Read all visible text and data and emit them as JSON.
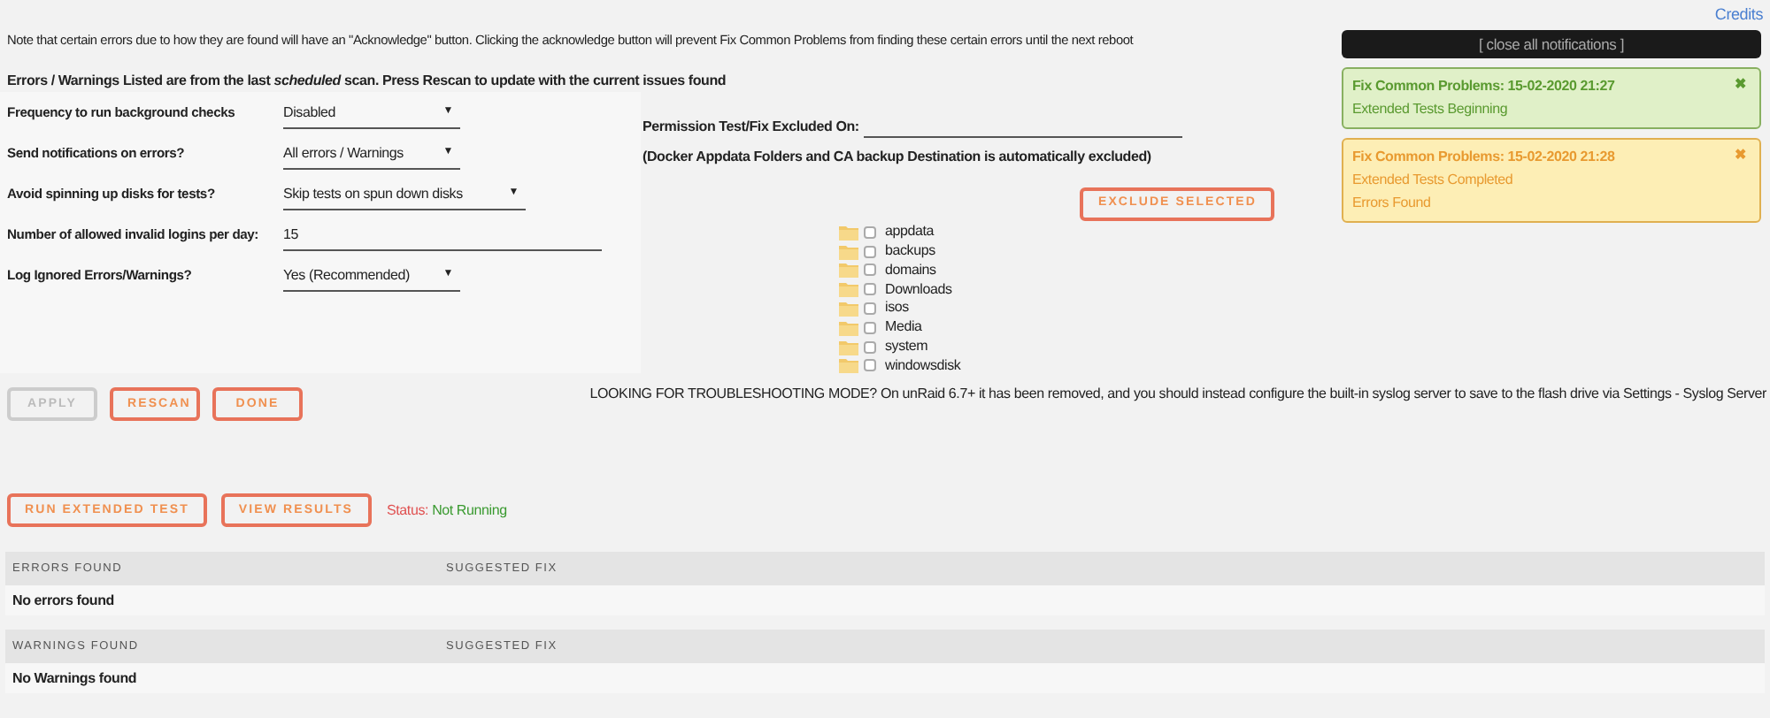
{
  "credits": "Credits",
  "note": "Note that certain errors due to how they are found will have an \"Acknowledge\" button. Clicking the acknowledge button will prevent Fix Common Problems from finding these certain errors until the next reboot",
  "scan_note": "Errors / Warnings Listed are from the last *scheduled* scan. Press Rescan to update with the current issues found",
  "settings": [
    {
      "label": "Frequency to run background checks",
      "kind": "select",
      "value": "Disabled",
      "arrow": "▼",
      "wide": false
    },
    {
      "label": "Send notifications on errors?",
      "kind": "select",
      "value": "All errors / Warnings",
      "arrow": "▼",
      "wide": false
    },
    {
      "label": "Avoid spinning up disks for tests?",
      "kind": "select",
      "value": "Skip tests on spun down disks",
      "arrow": "▼",
      "wide": true
    },
    {
      "label": "Number of allowed invalid logins per day:",
      "kind": "input",
      "value": "15"
    },
    {
      "label": "Log Ignored Errors/Warnings?",
      "kind": "select",
      "value": "Yes (Recommended)",
      "arrow": "▼",
      "wide": false
    }
  ],
  "permission": {
    "label": "Permission Test/Fix Excluded On:",
    "note": "(Docker Appdata Folders and CA backup Destination is automatically excluded)",
    "button": "EXCLUDE SELECTED",
    "folders": [
      {
        "name": "appdata",
        "checked": false
      },
      {
        "name": "backups",
        "checked": false
      },
      {
        "name": "domains",
        "checked": false
      },
      {
        "name": "Downloads",
        "checked": false
      },
      {
        "name": "isos",
        "checked": false
      },
      {
        "name": "Media",
        "checked": false
      },
      {
        "name": "system",
        "checked": false
      },
      {
        "name": "windowsdisk",
        "checked": false
      }
    ]
  },
  "buttons": [
    {
      "label": "APPLY",
      "disabled": true
    },
    {
      "label": "RESCAN",
      "disabled": false
    },
    {
      "label": "DONE",
      "disabled": false
    }
  ],
  "troubleshooting": "LOOKING FOR TROUBLESHOOTING MODE? On unRaid 6.7+ it has been removed, and you should instead configure the built-in syslog server to save to the flash drive via Settings - Syslog Server",
  "extended": {
    "buttons": [
      "RUN EXTENDED TEST",
      "VIEW RESULTS"
    ],
    "status_label": "Status:",
    "status": "Not Running"
  },
  "tables": [
    {
      "columns": [
        "ERRORS FOUND",
        "SUGGESTED FIX"
      ],
      "empty": "No errors found"
    },
    {
      "columns": [
        "WARNINGS FOUND",
        "SUGGESTED FIX"
      ],
      "empty": "No Warnings found"
    }
  ],
  "notifications": {
    "close_all": "[ close all notifications ]",
    "items": [
      {
        "kind": "success",
        "title": "Fix Common Problems: 15-02-2020 21:27",
        "lines": [
          "Extended Tests Beginning"
        ],
        "close": "✖"
      },
      {
        "kind": "warning",
        "title": "Fix Common Problems: 15-02-2020 21:28",
        "lines": [
          "Extended Tests Completed",
          "Errors Found"
        ],
        "close": "✖"
      }
    ]
  }
}
